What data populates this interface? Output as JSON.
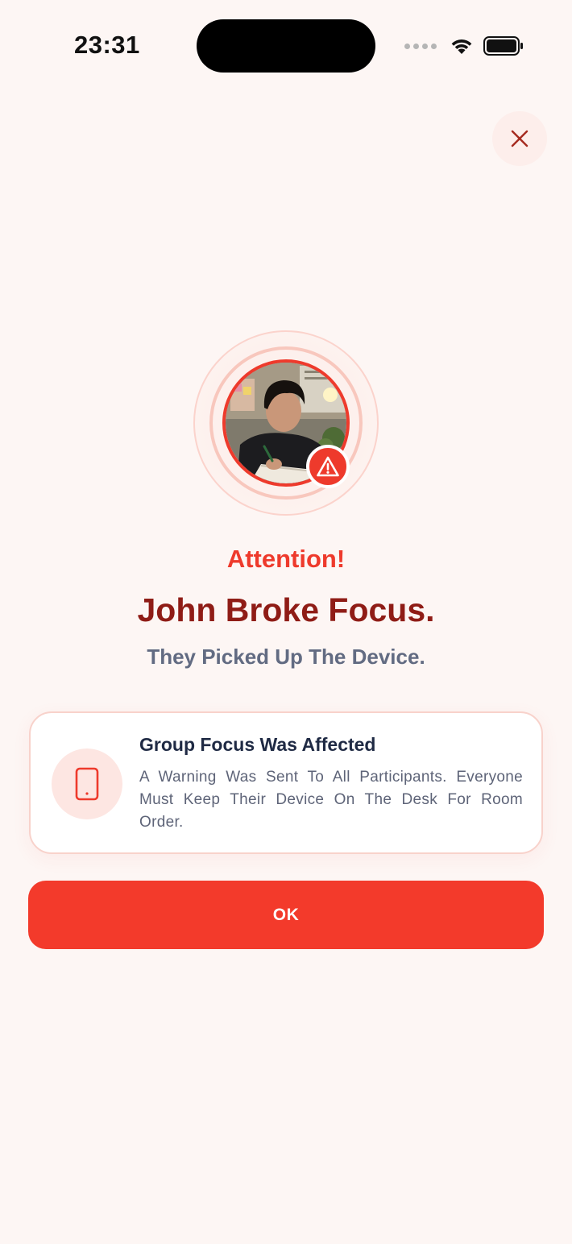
{
  "status_bar": {
    "time": "23:31"
  },
  "colors": {
    "accent": "#ee3a2c",
    "headline": "#8f1c16",
    "muted": "#626b82",
    "background": "#fdf6f4"
  },
  "icons": {
    "close": "close-icon",
    "alert": "warning-triangle-icon",
    "device": "tablet-icon"
  },
  "alert": {
    "label": "Attention!",
    "headline": "John Broke Focus.",
    "subline": "They Picked Up The Device."
  },
  "card": {
    "title": "Group Focus Was Affected",
    "text": "A Warning Was Sent To All Participants. Everyone Must Keep Their Device On The Desk For Room Order."
  },
  "actions": {
    "ok_label": "OK"
  }
}
